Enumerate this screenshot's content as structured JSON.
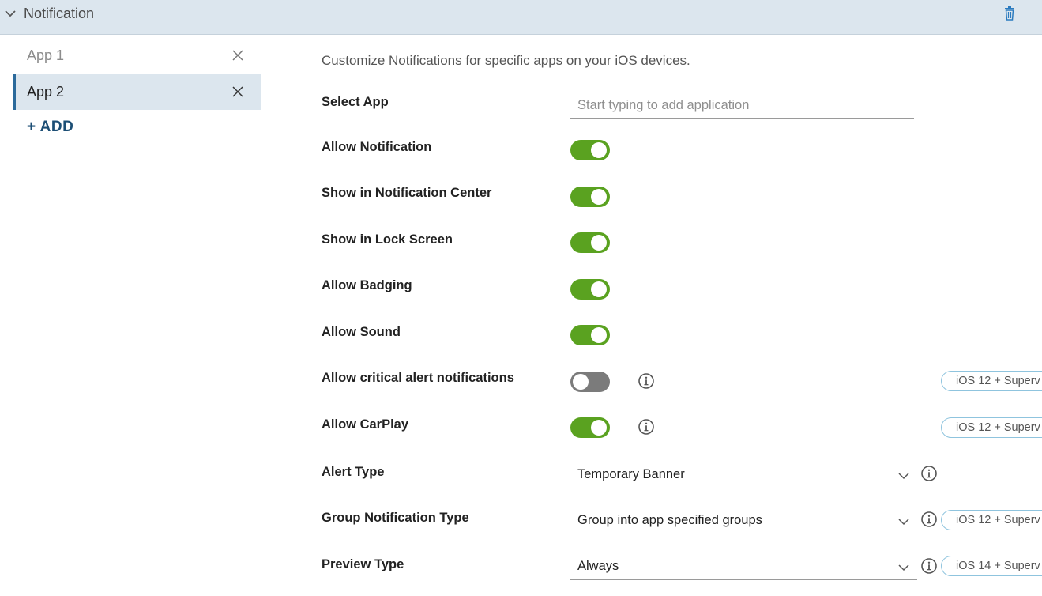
{
  "header": {
    "title": "Notification",
    "collapse_icon": "chevron-down-icon",
    "delete_icon": "trash-icon"
  },
  "sidebar": {
    "items": [
      {
        "label": "App 1",
        "active": false
      },
      {
        "label": "App 2",
        "active": true
      }
    ],
    "add_label": "+ ADD"
  },
  "main": {
    "description": "Customize Notifications for specific apps on your iOS devices.",
    "select_app": {
      "label": "Select App",
      "placeholder": "Start typing to add application",
      "value": ""
    },
    "toggles": [
      {
        "label": "Allow Notification",
        "on": true
      },
      {
        "label": "Show in Notification Center",
        "on": true
      },
      {
        "label": "Show in Lock Screen",
        "on": true
      },
      {
        "label": "Allow Badging",
        "on": true
      },
      {
        "label": "Allow Sound",
        "on": true
      },
      {
        "label": "Allow critical alert notifications",
        "on": false,
        "badge": "iOS 12 + Superv"
      },
      {
        "label": "Allow CarPlay",
        "on": true,
        "badge": "iOS 12 + Superv"
      }
    ],
    "selects": [
      {
        "label": "Alert Type",
        "value": "Temporary Banner"
      },
      {
        "label": "Group Notification Type",
        "value": "Group into app specified groups",
        "badge": "iOS 12 + Superv"
      },
      {
        "label": "Preview Type",
        "value": "Always",
        "badge": "iOS 14 + Superv"
      }
    ]
  },
  "colors": {
    "toggle_on": "#5aa220",
    "toggle_off": "#7b7b7b",
    "header_bg": "#dce6ee",
    "accent": "#2b6a9b",
    "add_text": "#1c4e75",
    "badge_border": "#8fc4de"
  }
}
